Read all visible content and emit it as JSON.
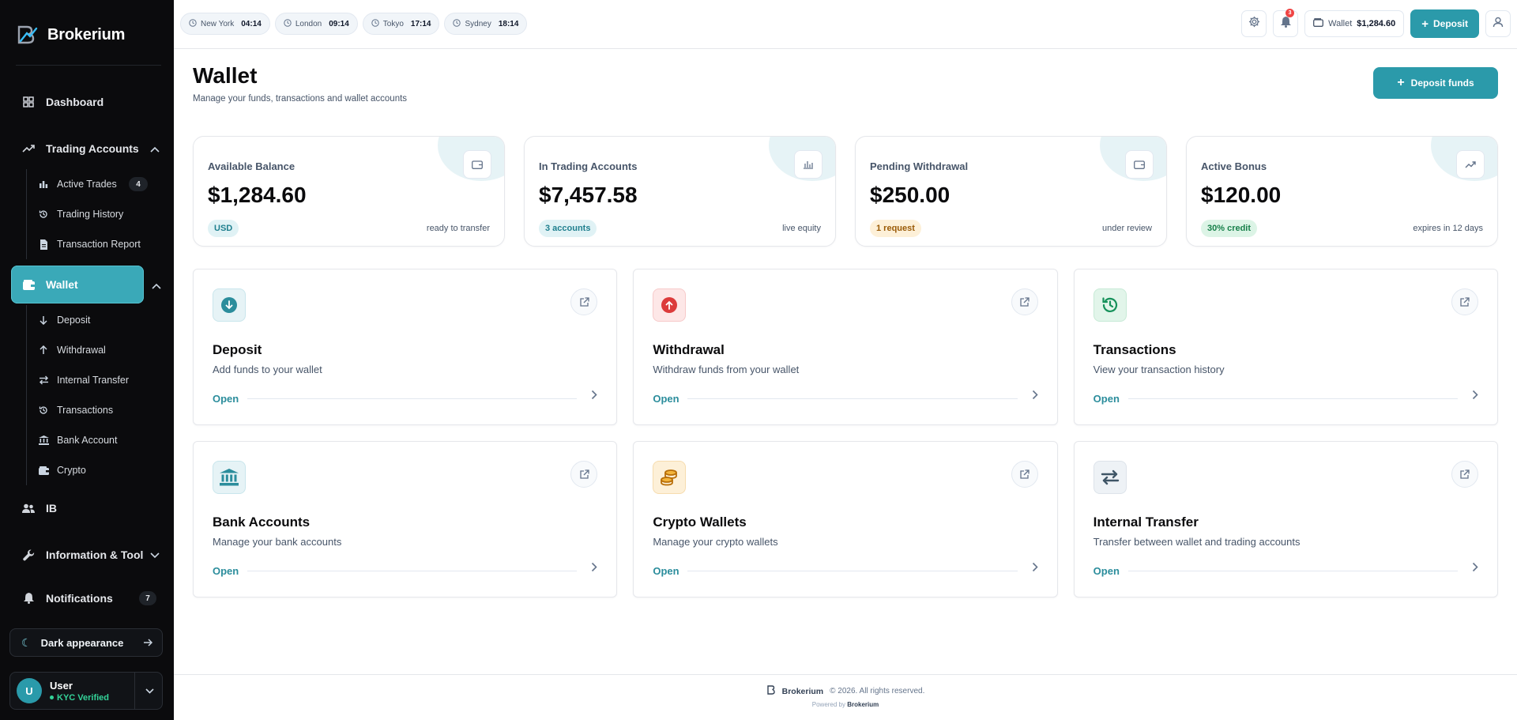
{
  "brand": {
    "name": "Brokerium"
  },
  "sidebar": {
    "dashboard": "Dashboard",
    "trading_accounts": "Trading Accounts",
    "trading_sub": [
      {
        "label": "Active Trades",
        "count": "4",
        "icon": "bar-chart-icon"
      },
      {
        "label": "Trading History",
        "icon": "history-icon"
      },
      {
        "label": "Transaction Report",
        "icon": "document-icon"
      }
    ],
    "wallet": "Wallet",
    "wallet_sub": [
      {
        "label": "Deposit",
        "icon": "arrow-down-icon"
      },
      {
        "label": "Withdrawal",
        "icon": "arrow-up-icon"
      },
      {
        "label": "Internal Transfer",
        "icon": "transfer-icon"
      },
      {
        "label": "Transactions",
        "icon": "history-icon"
      },
      {
        "label": "Bank Account",
        "icon": "bank-icon"
      },
      {
        "label": "Crypto",
        "icon": "wallet-icon"
      }
    ],
    "ib": "IB",
    "info_tools": "Information & Tool",
    "notifications": "Notifications",
    "notifications_count": "7",
    "dark_appearance": "Dark appearance",
    "user": {
      "initial": "U",
      "name": "User",
      "status": "KYC Verified"
    }
  },
  "topbar": {
    "clocks": [
      {
        "city": "New York",
        "time": "04:14"
      },
      {
        "city": "London",
        "time": "09:14"
      },
      {
        "city": "Tokyo",
        "time": "17:14"
      },
      {
        "city": "Sydney",
        "time": "18:14"
      }
    ],
    "notif_count": "3",
    "wallet_label": "Wallet",
    "wallet_amount": "$1,284.60",
    "deposit_label": "Deposit"
  },
  "page": {
    "title": "Wallet",
    "subtitle": "Manage your funds, transactions and wallet accounts",
    "deposit_funds": "Deposit funds"
  },
  "stats": [
    {
      "label": "Available Balance",
      "value": "$1,284.60",
      "badge": "USD",
      "note": "ready to transfer",
      "icon": "wallet-icon"
    },
    {
      "label": "In Trading Accounts",
      "value": "$7,457.58",
      "badge": "3 accounts",
      "note": "live equity",
      "icon": "bar-chart-icon"
    },
    {
      "label": "Pending Withdrawal",
      "value": "$250.00",
      "badge": "1 request",
      "note": "under review",
      "icon": "wallet-icon"
    },
    {
      "label": "Active Bonus",
      "value": "$120.00",
      "badge": "30% credit",
      "note": "expires in 12 days",
      "icon": "trend-up-icon"
    }
  ],
  "cards": [
    {
      "title": "Deposit",
      "desc": "Add funds to your wallet",
      "open": "Open"
    },
    {
      "title": "Withdrawal",
      "desc": "Withdraw funds from your wallet",
      "open": "Open"
    },
    {
      "title": "Transactions",
      "desc": "View your transaction history",
      "open": "Open"
    },
    {
      "title": "Bank Accounts",
      "desc": "Manage your bank accounts",
      "open": "Open"
    },
    {
      "title": "Crypto Wallets",
      "desc": "Manage your crypto wallets",
      "open": "Open"
    },
    {
      "title": "Internal Transfer",
      "desc": "Transfer between wallet and trading accounts",
      "open": "Open"
    }
  ],
  "footer": {
    "brand": "Brokerium",
    "copyright": "© 2026. All rights reserved.",
    "powered_prefix": "Powered by",
    "powered_brand": "Brokerium"
  },
  "colors": {
    "accent": "#2b9aaa",
    "sidebar_bg": "#0b0b0d",
    "active_nav": "#3aa9b8"
  }
}
